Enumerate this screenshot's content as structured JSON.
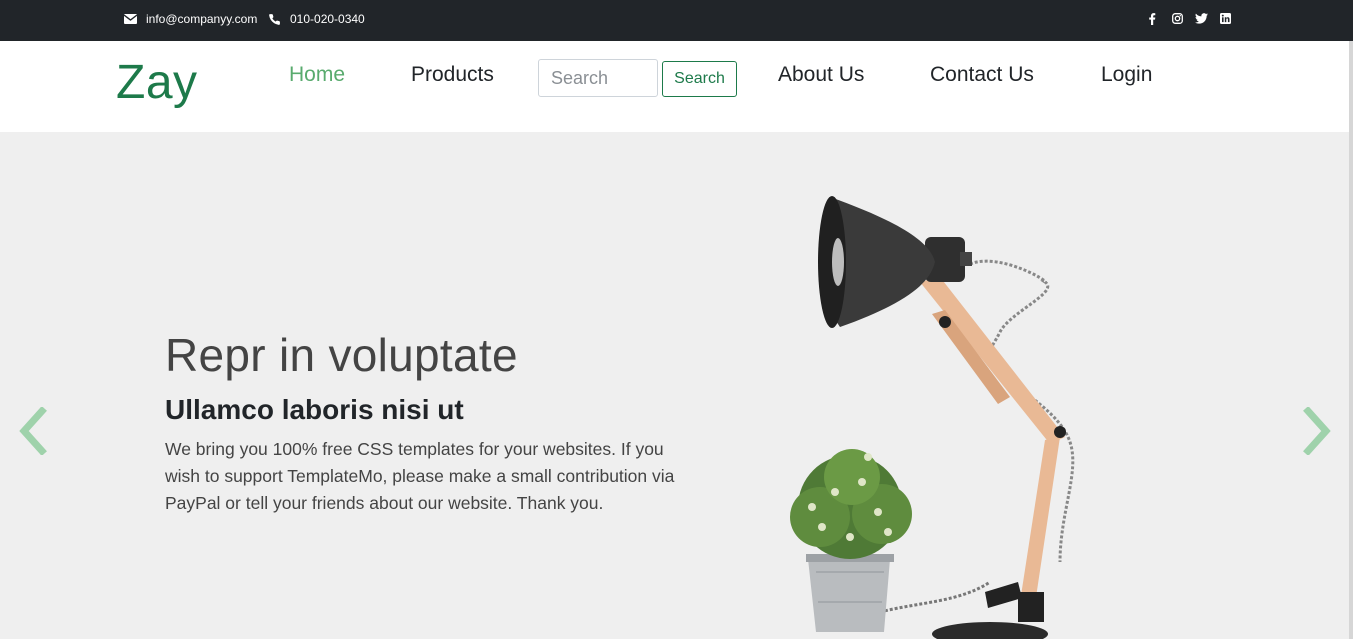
{
  "topbar": {
    "email": "info@companyy.com",
    "phone": "010-020-0340",
    "social": [
      "facebook-icon",
      "instagram-icon",
      "twitter-icon",
      "linkedin-icon"
    ]
  },
  "navbar": {
    "brand": "Zay",
    "links": [
      {
        "label": "Home",
        "active": true
      },
      {
        "label": "Products",
        "active": false
      },
      {
        "label": "About Us",
        "active": false
      },
      {
        "label": "Contact Us",
        "active": false
      },
      {
        "label": "Login",
        "active": false
      }
    ],
    "search": {
      "placeholder": "Search",
      "value": "",
      "button_label": "Search"
    }
  },
  "hero": {
    "title": "Repr in voluptate",
    "subtitle": "Ullamco laboris nisi ut",
    "text": "We bring you 100% free CSS templates for your websites. If you wish to support TemplateMo, please make a small contribution via PayPal or tell your friends about our website. Thank you.",
    "prev_icon": "chevron-left-icon",
    "next_icon": "chevron-right-icon"
  },
  "colors": {
    "accent": "#59ab6e",
    "brand": "#1d7a4a",
    "topbar": "#212529",
    "hero_bg": "#efefef"
  }
}
